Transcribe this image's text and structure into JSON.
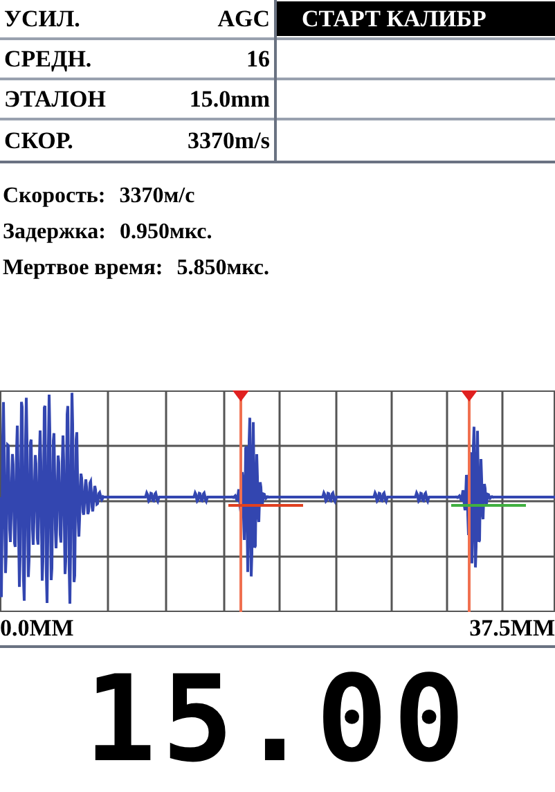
{
  "settings": [
    {
      "label": "УСИЛ.",
      "value": "AGC"
    },
    {
      "label": "СРЕДН.",
      "value": "16"
    },
    {
      "label": "ЭТАЛОН",
      "value": "15.0mm"
    },
    {
      "label": "СКОР.",
      "value": "3370m/s"
    }
  ],
  "menu": [
    {
      "label": "СТАРТ КАЛИБР",
      "selected": true
    }
  ],
  "info": [
    {
      "label": "Скорость:",
      "value": "3370м/с"
    },
    {
      "label": "Задержка:",
      "value": "0.950мкс."
    },
    {
      "label": "Мертвое время:",
      "value": "5.850мкс."
    }
  ],
  "scan": {
    "start_label": "0.0MM",
    "end_label": "37.5MM"
  },
  "reading": "15.00"
}
